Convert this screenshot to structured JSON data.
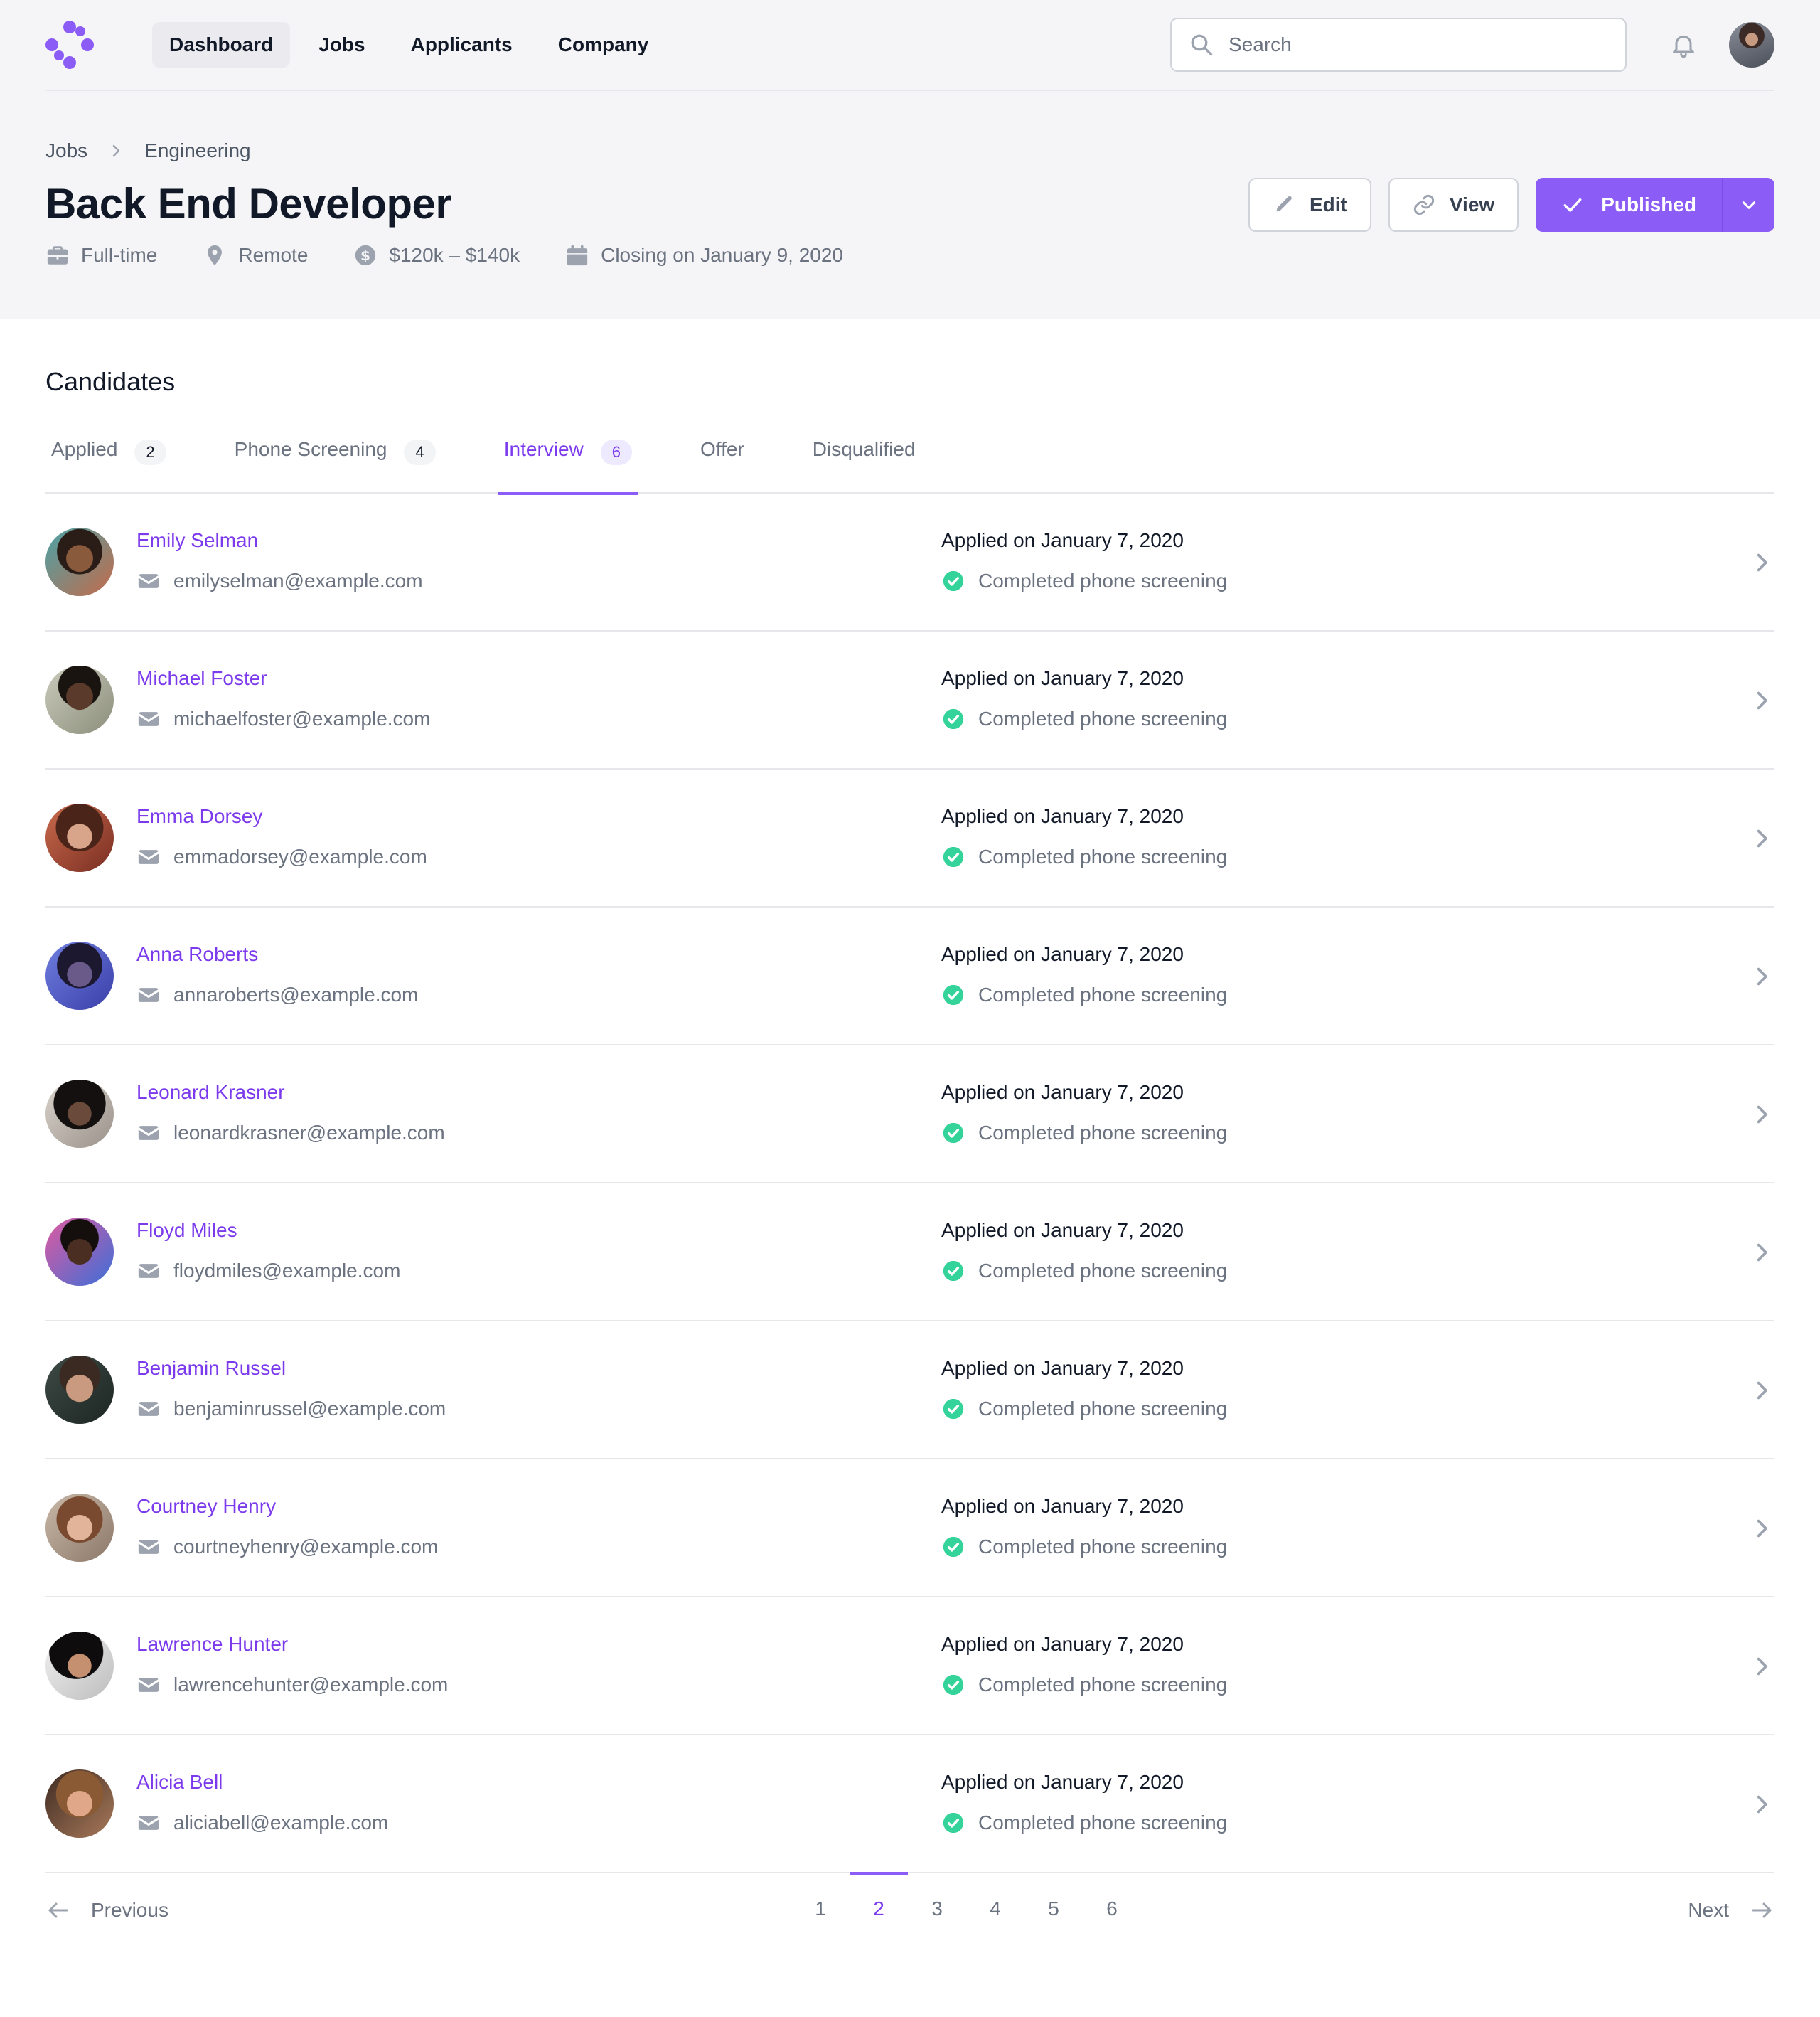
{
  "nav": {
    "links": [
      {
        "label": "Dashboard",
        "active": true
      },
      {
        "label": "Jobs"
      },
      {
        "label": "Applicants"
      },
      {
        "label": "Company"
      }
    ],
    "search_placeholder": "Search"
  },
  "breadcrumb": {
    "root": "Jobs",
    "current": "Engineering"
  },
  "job": {
    "title": "Back End Developer",
    "type": "Full-time",
    "location": "Remote",
    "salary": "$120k – $140k",
    "closing": "Closing on January 9, 2020"
  },
  "actions": {
    "edit": "Edit",
    "view": "View",
    "published": "Published"
  },
  "candidates": {
    "title": "Candidates",
    "tabs": [
      {
        "label": "Applied",
        "count": "2"
      },
      {
        "label": "Phone Screening",
        "count": "4"
      },
      {
        "label": "Interview",
        "count": "6",
        "active": true
      },
      {
        "label": "Offer"
      },
      {
        "label": "Disqualified"
      }
    ],
    "rows": [
      {
        "name": "Emily Selman",
        "email": "emilyselman@example.com",
        "applied": "Applied on January 7, 2020",
        "status": "Completed phone screening"
      },
      {
        "name": "Michael Foster",
        "email": "michaelfoster@example.com",
        "applied": "Applied on January 7, 2020",
        "status": "Completed phone screening"
      },
      {
        "name": "Emma Dorsey",
        "email": "emmadorsey@example.com",
        "applied": "Applied on January 7, 2020",
        "status": "Completed phone screening"
      },
      {
        "name": "Anna Roberts",
        "email": "annaroberts@example.com",
        "applied": "Applied on January 7, 2020",
        "status": "Completed phone screening"
      },
      {
        "name": "Leonard Krasner",
        "email": "leonardkrasner@example.com",
        "applied": "Applied on January 7, 2020",
        "status": "Completed phone screening"
      },
      {
        "name": "Floyd Miles",
        "email": "floydmiles@example.com",
        "applied": "Applied on January 7, 2020",
        "status": "Completed phone screening"
      },
      {
        "name": "Benjamin Russel",
        "email": "benjaminrussel@example.com",
        "applied": "Applied on January 7, 2020",
        "status": "Completed phone screening"
      },
      {
        "name": "Courtney Henry",
        "email": "courtneyhenry@example.com",
        "applied": "Applied on January 7, 2020",
        "status": "Completed phone screening"
      },
      {
        "name": "Lawrence Hunter",
        "email": "lawrencehunter@example.com",
        "applied": "Applied on January 7, 2020",
        "status": "Completed phone screening"
      },
      {
        "name": "Alicia Bell",
        "email": "aliciabell@example.com",
        "applied": "Applied on January 7, 2020",
        "status": "Completed phone screening"
      }
    ]
  },
  "pagination": {
    "previous": "Previous",
    "next": "Next",
    "pages": [
      "1",
      "2",
      "3",
      "4",
      "5",
      "6"
    ],
    "current": "2"
  },
  "colors": {
    "accent": "#8b5cf6",
    "success": "#34d399"
  },
  "icons": [
    "logo-icon",
    "search-icon",
    "bell-icon",
    "briefcase-icon",
    "location-icon",
    "currency-icon",
    "calendar-icon",
    "pencil-icon",
    "link-icon",
    "check-icon",
    "chevron-down-icon",
    "mail-icon",
    "check-circle-icon",
    "chevron-right-icon",
    "arrow-left-icon",
    "arrow-right-icon"
  ]
}
